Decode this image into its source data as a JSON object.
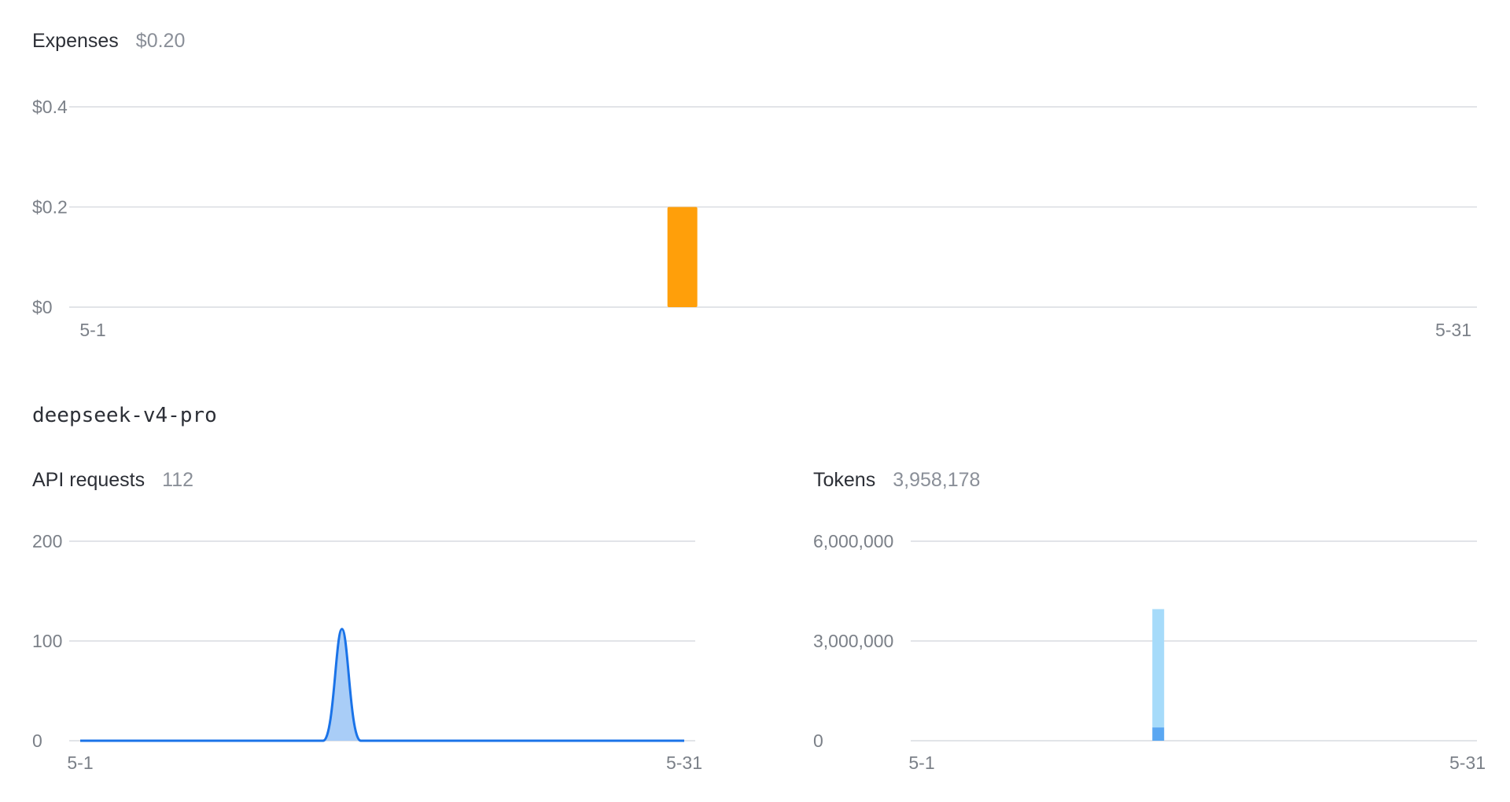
{
  "expenses": {
    "label": "Expenses",
    "total": "$0.20",
    "chart_data": {
      "type": "bar",
      "x_ticks": [
        "5-1",
        "5-31"
      ],
      "y_ticks": [
        "$0",
        "$0.2",
        "$0.4"
      ],
      "ylim": [
        0,
        0.4
      ],
      "days": 31,
      "bars": [
        {
          "day": 14,
          "value": 0.2
        }
      ],
      "color": "#ff9f0a"
    }
  },
  "model_name": "deepseek-v4-pro",
  "api_requests": {
    "label": "API requests",
    "total": "112",
    "chart_data": {
      "type": "area",
      "x_ticks": [
        "5-1",
        "5-31"
      ],
      "y_ticks": [
        "0",
        "100",
        "200"
      ],
      "ylim": [
        0,
        200
      ],
      "days": 31,
      "peak": {
        "day": 14,
        "value": 112
      },
      "line_color": "#1a73e8",
      "fill_color": "#a9cdf7"
    }
  },
  "tokens": {
    "label": "Tokens",
    "total": "3,958,178",
    "chart_data": {
      "type": "bar",
      "x_ticks": [
        "5-1",
        "5-31"
      ],
      "y_ticks": [
        "0",
        "3,000,000",
        "6,000,000"
      ],
      "ylim": [
        0,
        6000000
      ],
      "days": 31,
      "series": [
        {
          "values": [
            {
              "day": 14,
              "value": 400000
            }
          ],
          "color": "#5aa7f2"
        },
        {
          "values": [
            {
              "day": 14,
              "value": 3558178
            }
          ],
          "color": "#a6dbfa"
        }
      ]
    }
  }
}
